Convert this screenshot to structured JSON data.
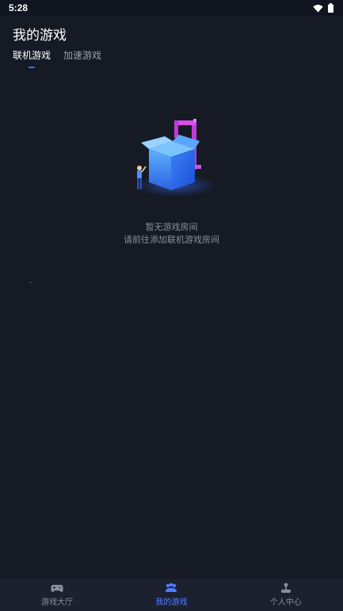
{
  "status_bar": {
    "time": "5:28",
    "icons": [
      "wifi-icon",
      "battery-icon"
    ]
  },
  "header": {
    "title": "我的游戏"
  },
  "tabs": [
    {
      "label": "联机游戏",
      "active": true
    },
    {
      "label": "加速游戏",
      "active": false
    }
  ],
  "empty_state": {
    "title": "暂无游戏房间",
    "subtitle": "请前往添加联机游戏房间",
    "illustration": "empty-box-illustration"
  },
  "bottom_nav": [
    {
      "label": "游戏大厅",
      "icon": "gamepad-icon",
      "active": false
    },
    {
      "label": "我的游戏",
      "icon": "my-games-icon",
      "active": true
    },
    {
      "label": "个人中心",
      "icon": "joystick-icon",
      "active": false
    }
  ],
  "colors": {
    "background": "#161a25",
    "accent": "#3f6fff",
    "nav_background": "#1c2130",
    "muted_text": "#8a8f9a"
  }
}
